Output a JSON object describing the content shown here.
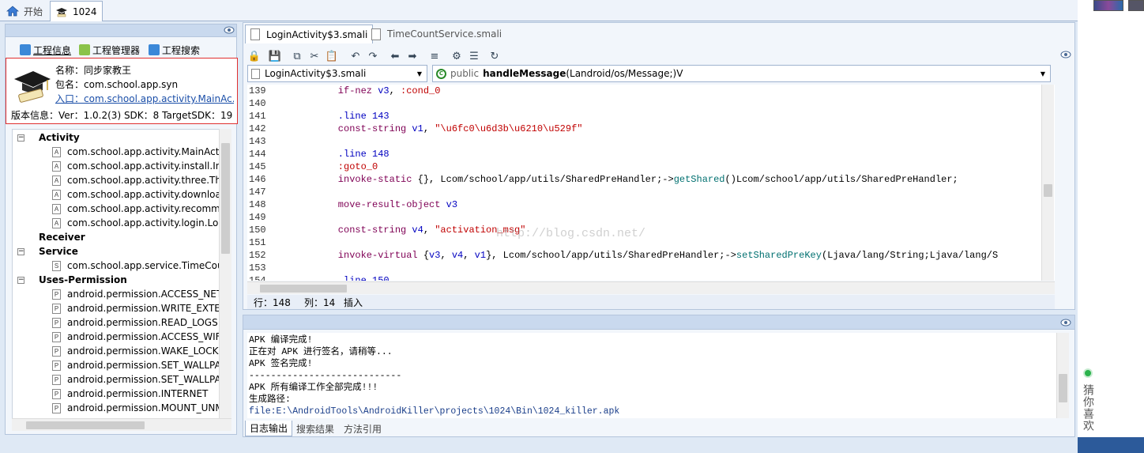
{
  "top_tabs": [
    {
      "label": "开始"
    },
    {
      "label": "1024"
    }
  ],
  "left_panel": {
    "tabs": [
      {
        "label": "工程信息"
      },
      {
        "label": "工程管理器"
      },
      {
        "label": "工程搜索"
      }
    ],
    "project": {
      "name_label": "名称：同步家教王",
      "package_label": "包名：com.school.app.syn",
      "entry_label": "入口：com.school.app.activity.MainAc...",
      "version_label": "版本信息：Ver：1.0.2(3) SDK：8 TargetSDK：19"
    },
    "tree": [
      {
        "kind": "group",
        "label": "Activity"
      },
      {
        "kind": "item",
        "badge": "A",
        "label": "com.school.app.activity.MainActivity"
      },
      {
        "kind": "item",
        "badge": "A",
        "label": "com.school.app.activity.install.InstallActivity"
      },
      {
        "kind": "item",
        "badge": "A",
        "label": "com.school.app.activity.three.ThreeActivity"
      },
      {
        "kind": "item",
        "badge": "A",
        "label": "com.school.app.activity.download.DownloadActivity"
      },
      {
        "kind": "item",
        "badge": "A",
        "label": "com.school.app.activity.recommend.RecommendActivity"
      },
      {
        "kind": "item",
        "badge": "A",
        "label": "com.school.app.activity.login.LoginActivity"
      },
      {
        "kind": "group",
        "label": "Receiver",
        "noicon": true
      },
      {
        "kind": "group",
        "label": "Service"
      },
      {
        "kind": "item",
        "badge": "S",
        "label": "com.school.app.service.TimeCountService"
      },
      {
        "kind": "group",
        "label": "Uses-Permission"
      },
      {
        "kind": "item",
        "badge": "P",
        "label": "android.permission.ACCESS_NETWORK_STATE"
      },
      {
        "kind": "item",
        "badge": "P",
        "label": "android.permission.WRITE_EXTERNAL_STORAGE"
      },
      {
        "kind": "item",
        "badge": "P",
        "label": "android.permission.READ_LOGS"
      },
      {
        "kind": "item",
        "badge": "P",
        "label": "android.permission.ACCESS_WIFI_STATE"
      },
      {
        "kind": "item",
        "badge": "P",
        "label": "android.permission.WAKE_LOCK"
      },
      {
        "kind": "item",
        "badge": "P",
        "label": "android.permission.SET_WALLPAPER"
      },
      {
        "kind": "item",
        "badge": "P",
        "label": "android.permission.SET_WALLPAPER_HINTS"
      },
      {
        "kind": "item",
        "badge": "P",
        "label": "android.permission.INTERNET"
      },
      {
        "kind": "item",
        "badge": "P",
        "label": "android.permission.MOUNT_UNMOUNT_FILESYSTEMS"
      }
    ]
  },
  "editor": {
    "tabs": [
      {
        "label": "LoginActivity$3.smali"
      },
      {
        "label": "TimeCountService.smali"
      }
    ],
    "file_combo": "LoginActivity$3.smali",
    "method_combo": {
      "modifier": "public",
      "name": "handleMessage",
      "sig": "(Landroid/os/Message;)V"
    },
    "lines": [
      {
        "n": "139",
        "segs": [
          {
            "t": "    if-nez ",
            "c": "kw"
          },
          {
            "t": "v3",
            "c": "reg"
          },
          {
            "t": ", ",
            "c": ""
          },
          {
            "t": ":cond_0",
            "c": "lbl"
          }
        ]
      },
      {
        "n": "140",
        "segs": []
      },
      {
        "n": "141",
        "segs": [
          {
            "t": "    .line 143",
            "c": "dir"
          }
        ]
      },
      {
        "n": "142",
        "segs": [
          {
            "t": "    const-string ",
            "c": "kw"
          },
          {
            "t": "v1",
            "c": "reg"
          },
          {
            "t": ", ",
            "c": ""
          },
          {
            "t": "\"\\u6fc0\\u6d3b\\u6210\\u529f\"",
            "c": "str"
          }
        ]
      },
      {
        "n": "143",
        "segs": []
      },
      {
        "n": "144",
        "segs": [
          {
            "t": "    .line 148",
            "c": "dir"
          }
        ]
      },
      {
        "n": "145",
        "segs": [
          {
            "t": "    :goto_0",
            "c": "lbl"
          }
        ]
      },
      {
        "n": "146",
        "segs": [
          {
            "t": "    invoke-static ",
            "c": "kw"
          },
          {
            "t": "{}, Lcom/school/app/utils/SharedPreHandler;->",
            "c": ""
          },
          {
            "t": "getShared",
            "c": "meth"
          },
          {
            "t": "()Lcom/school/app/utils/SharedPreHandler;",
            "c": ""
          }
        ]
      },
      {
        "n": "147",
        "segs": []
      },
      {
        "n": "148",
        "segs": [
          {
            "t": "    move-result-object ",
            "c": "kw"
          },
          {
            "t": "v3",
            "c": "reg"
          }
        ]
      },
      {
        "n": "149",
        "segs": []
      },
      {
        "n": "150",
        "segs": [
          {
            "t": "    const-string ",
            "c": "kw"
          },
          {
            "t": "v4",
            "c": "reg"
          },
          {
            "t": ", ",
            "c": ""
          },
          {
            "t": "\"activation_msg\"",
            "c": "str"
          }
        ]
      },
      {
        "n": "151",
        "segs": []
      },
      {
        "n": "152",
        "segs": [
          {
            "t": "    invoke-virtual ",
            "c": "kw"
          },
          {
            "t": "{",
            "c": ""
          },
          {
            "t": "v3",
            "c": "reg"
          },
          {
            "t": ", ",
            "c": ""
          },
          {
            "t": "v4",
            "c": "reg"
          },
          {
            "t": ", ",
            "c": ""
          },
          {
            "t": "v1",
            "c": "reg"
          },
          {
            "t": "}, Lcom/school/app/utils/SharedPreHandler;->",
            "c": ""
          },
          {
            "t": "setSharedPreKey",
            "c": "meth"
          },
          {
            "t": "(Ljava/lang/String;Ljava/lang/S",
            "c": ""
          }
        ]
      },
      {
        "n": "153",
        "segs": []
      },
      {
        "n": "154",
        "segs": [
          {
            "t": "    .line 150",
            "c": "dir"
          }
        ]
      }
    ],
    "watermark": "http://blog.csdn.net/",
    "status": {
      "row": "行：148",
      "col": "列：14",
      "mode": "插入"
    }
  },
  "output": {
    "lines": [
      {
        "t": "APK 编译完成!",
        "c": ""
      },
      {
        "t": "正在对 APK 进行签名，请稍等...",
        "c": ""
      },
      {
        "t": "APK 签名完成!",
        "c": ""
      },
      {
        "t": "----------------------------",
        "c": ""
      },
      {
        "t": "APK 所有编译工作全部完成!!!",
        "c": ""
      },
      {
        "t": "生成路径:",
        "c": ""
      },
      {
        "t": "file:E:\\AndroidTools\\AndroidKiller\\projects\\1024\\Bin\\1024_killer.apk",
        "c": "link"
      }
    ],
    "tabs": [
      {
        "label": "日志输出"
      },
      {
        "label": "搜索结果"
      },
      {
        "label": "方法引用"
      }
    ]
  },
  "side_widget": {
    "label": "猜你喜欢"
  },
  "colors": {
    "accent": "#0000c0",
    "string": "#c00000",
    "keyword": "#7f0055",
    "highlight_box": "#e03030"
  }
}
